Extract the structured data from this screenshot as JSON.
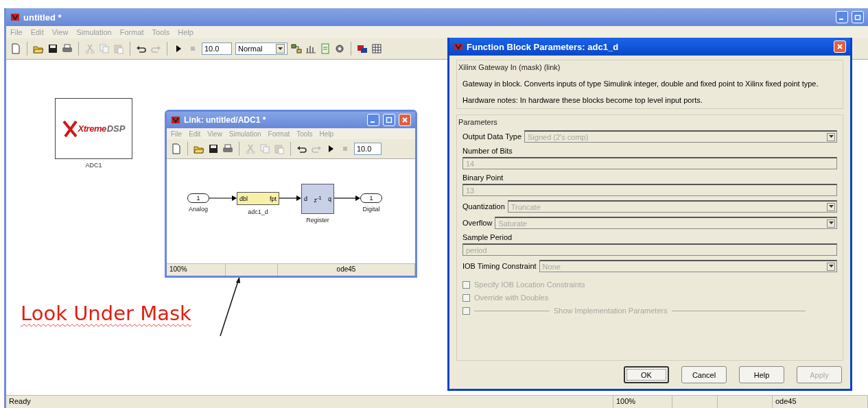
{
  "window": {
    "title": "untitled *"
  },
  "menu": [
    "File",
    "Edit",
    "View",
    "Simulation",
    "Format",
    "Tools",
    "Help"
  ],
  "toolbar": {
    "stop_time": "10.0",
    "mode": "Normal"
  },
  "canvas": {
    "block": {
      "logo": [
        "Xtreme",
        "DSP"
      ],
      "label": "ADC1"
    },
    "annotation": "Look Under Mask"
  },
  "link_window": {
    "title": "Link: untitled/ADC1 *",
    "menu": [
      "File",
      "Edit",
      "View",
      "Simulation",
      "Format",
      "Tools",
      "Help"
    ],
    "stop_time": "10.0",
    "blocks": [
      {
        "kind": "inport",
        "number": "1",
        "label": "Analog"
      },
      {
        "kind": "gateway",
        "input": "dbl",
        "output": "fpt",
        "label": "adc1_d"
      },
      {
        "kind": "register",
        "input": "d",
        "op": "z$^{-1}$",
        "output": "q",
        "label": "Register"
      },
      {
        "kind": "outport",
        "number": "1",
        "label": "Digital"
      }
    ],
    "status": {
      "zoom": "100%",
      "solver": "ode45"
    }
  },
  "dialog": {
    "title": "Function Block Parameters: adc1_d",
    "group": "Xilinx Gateway In (mask) (link)",
    "description": "Gateway in block.  Converts inputs of type Simulink integer, double and fixed point to Xilinx fixed point type.",
    "notes": "Hardware notes:  In hardware these blocks become top level input ports.",
    "parameters_title": "Parameters",
    "fields": [
      {
        "kind": "dropdown",
        "label": "Output Data Type",
        "value": "Signed  (2's comp)",
        "disabled": true
      },
      {
        "kind": "text",
        "label": "Number of Bits",
        "value": "14",
        "disabled": true
      },
      {
        "kind": "text",
        "label": "Binary Point",
        "value": "13",
        "disabled": true
      },
      {
        "kind": "dropdown",
        "label": "Quantization",
        "value": "Truncate",
        "disabled": true
      },
      {
        "kind": "dropdown",
        "label": "Overflow",
        "value": "Saturate",
        "disabled": true
      },
      {
        "kind": "text",
        "label": "Sample Period",
        "value": "period",
        "disabled": true
      },
      {
        "kind": "dropdown",
        "label": "IOB Timing Constraint",
        "value": "None",
        "disabled": true
      }
    ],
    "checkboxes": [
      {
        "kind": "option",
        "label": "Specify IOB Location Constraints",
        "checked": false,
        "disabled": true
      },
      {
        "kind": "option",
        "label": "Override with Doubles",
        "checked": false,
        "disabled": true
      },
      {
        "kind": "section",
        "label": "Show Implementation Parameters",
        "checked": false,
        "disabled": true
      }
    ],
    "buttons": [
      {
        "label": "OK",
        "default": true,
        "disabled": false
      },
      {
        "label": "Cancel",
        "default": false,
        "disabled": false
      },
      {
        "label": "Help",
        "default": false,
        "disabled": false
      },
      {
        "label": "Apply",
        "default": false,
        "disabled": true
      }
    ]
  },
  "status_bar": {
    "text": "Ready",
    "zoom": "100%",
    "solver": "ode45"
  }
}
